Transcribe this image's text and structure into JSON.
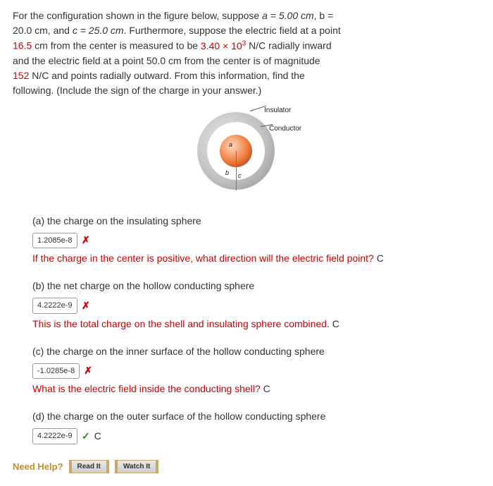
{
  "question": {
    "line1_pre": "For the configuration shown in the figure below, suppose ",
    "a_eq": "a = 5.00 cm",
    "line1_post": ", b =",
    "line2_pre": "20.0 cm, and ",
    "c_eq": "c = 25.0 cm",
    "line2_post": ". Furthermore, suppose the electric field at a point",
    "r1": "16.5",
    "line3_mid": " cm from the center is measured to be ",
    "e1": "3.40 × 10",
    "e1_sup": "3",
    "line3_post": " N/C radially inward",
    "line4": "and the electric field at a point 50.0 cm from the center is of magnitude",
    "e2": "152",
    "line5_post": " N/C and points radially outward. From this information, find the",
    "line6": "following. (Include the sign of the charge in your answer.)"
  },
  "figure": {
    "label_insulator": "Insulator",
    "label_conductor": "Conductor",
    "a": "a",
    "b": "b",
    "c": "c"
  },
  "parts": {
    "a": {
      "label": "(a) the charge on the insulating sphere",
      "value": "1.2085e-8",
      "mark": "✗",
      "feedback": "If the charge in the center is positive, what direction will the electric field point?",
      "unit": "C"
    },
    "b": {
      "label": "(b) the net charge on the hollow conducting sphere",
      "value": "4.2222e-9",
      "mark": "✗",
      "feedback": "This is the total charge on the shell and insulating sphere combined.",
      "unit": "C"
    },
    "c": {
      "label": "(c) the charge on the inner surface of the hollow conducting sphere",
      "value": "-1.0285e-8",
      "mark": "✗",
      "feedback": "What is the electric field inside the conducting shell?",
      "unit": "C"
    },
    "d": {
      "label": "(d) the charge on the outer surface of the hollow conducting sphere",
      "value": "4.2222e-9",
      "mark": "✓",
      "unit": "C"
    }
  },
  "help": {
    "label": "Need Help?",
    "read": "Read It",
    "watch": "Watch It"
  }
}
